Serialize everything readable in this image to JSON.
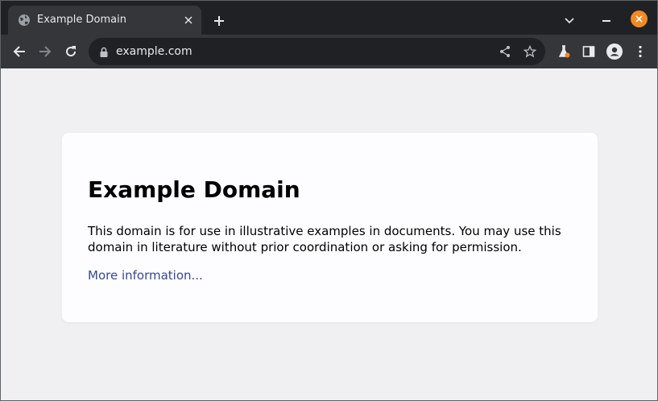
{
  "browser": {
    "tab": {
      "title": "Example Domain",
      "favicon": "globe-icon"
    },
    "toolbar": {
      "url": "example.com",
      "icons": [
        "back-arrow-icon",
        "forward-arrow-icon",
        "reload-icon",
        "lock-icon",
        "share-icon",
        "star-icon",
        "extension-flask-icon",
        "side-panel-icon",
        "profile-icon",
        "menu-dots-icon"
      ]
    },
    "window_controls": [
      "chevron-down-icon",
      "minimize-icon",
      "close-icon"
    ],
    "colors": {
      "frame": "#202124",
      "toolbar": "#35363a",
      "close_button": "#f08a24"
    }
  },
  "page": {
    "heading": "Example Domain",
    "paragraph": "This domain is for use in illustrative examples in documents. You may use this domain in literature without prior coordination or asking for permission.",
    "link_text": "More information...",
    "colors": {
      "background": "#f0f0f2",
      "card": "#fdfdff",
      "link": "#38488f"
    }
  }
}
